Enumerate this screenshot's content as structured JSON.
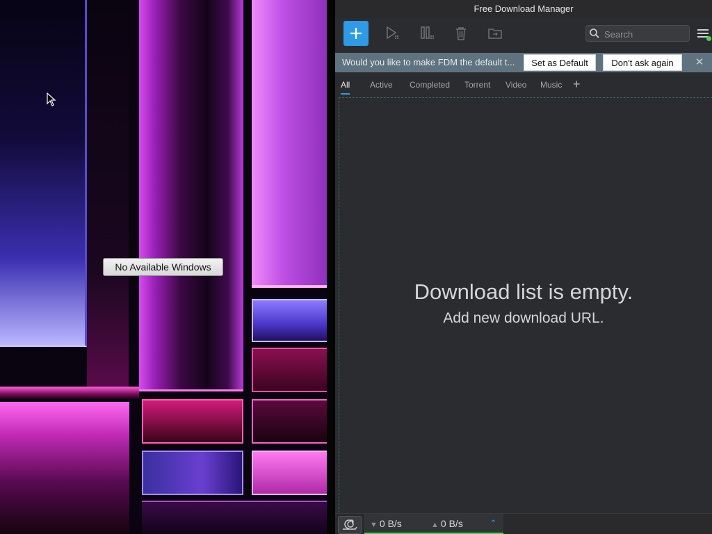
{
  "desktop": {
    "popup_label": "No Available Windows"
  },
  "app": {
    "title": "Free Download Manager",
    "toolbar": {
      "add_icon": "plus-icon",
      "play_icon": "play-icon",
      "pause_icon": "pause-icon",
      "delete_icon": "trash-icon",
      "folder_icon": "folder-icon",
      "search_placeholder": "Search",
      "menu_icon": "hamburger-menu-icon"
    },
    "banner": {
      "text": "Would you like to make FDM the default t...",
      "set_default_label": "Set as Default",
      "dont_ask_label": "Don't ask again",
      "close_glyph": "✕"
    },
    "tabs": [
      {
        "label": "All",
        "active": true
      },
      {
        "label": "Active",
        "active": false
      },
      {
        "label": "Completed",
        "active": false
      },
      {
        "label": "Torrent",
        "active": false
      },
      {
        "label": "Video",
        "active": false
      },
      {
        "label": "Music",
        "active": false
      }
    ],
    "tab_add_glyph": "+",
    "empty_state": {
      "title": "Download list is empty.",
      "subtitle": "Add new download URL."
    },
    "status": {
      "download_speed": "0 B/s",
      "upload_speed": "0 B/s",
      "down_arrow": "▼",
      "up_arrow": "▲",
      "expand_glyph": "⌃"
    },
    "colors": {
      "accent": "#2f9be6",
      "status_ok": "#4cd14c",
      "banner_bg": "#5f7280"
    }
  }
}
